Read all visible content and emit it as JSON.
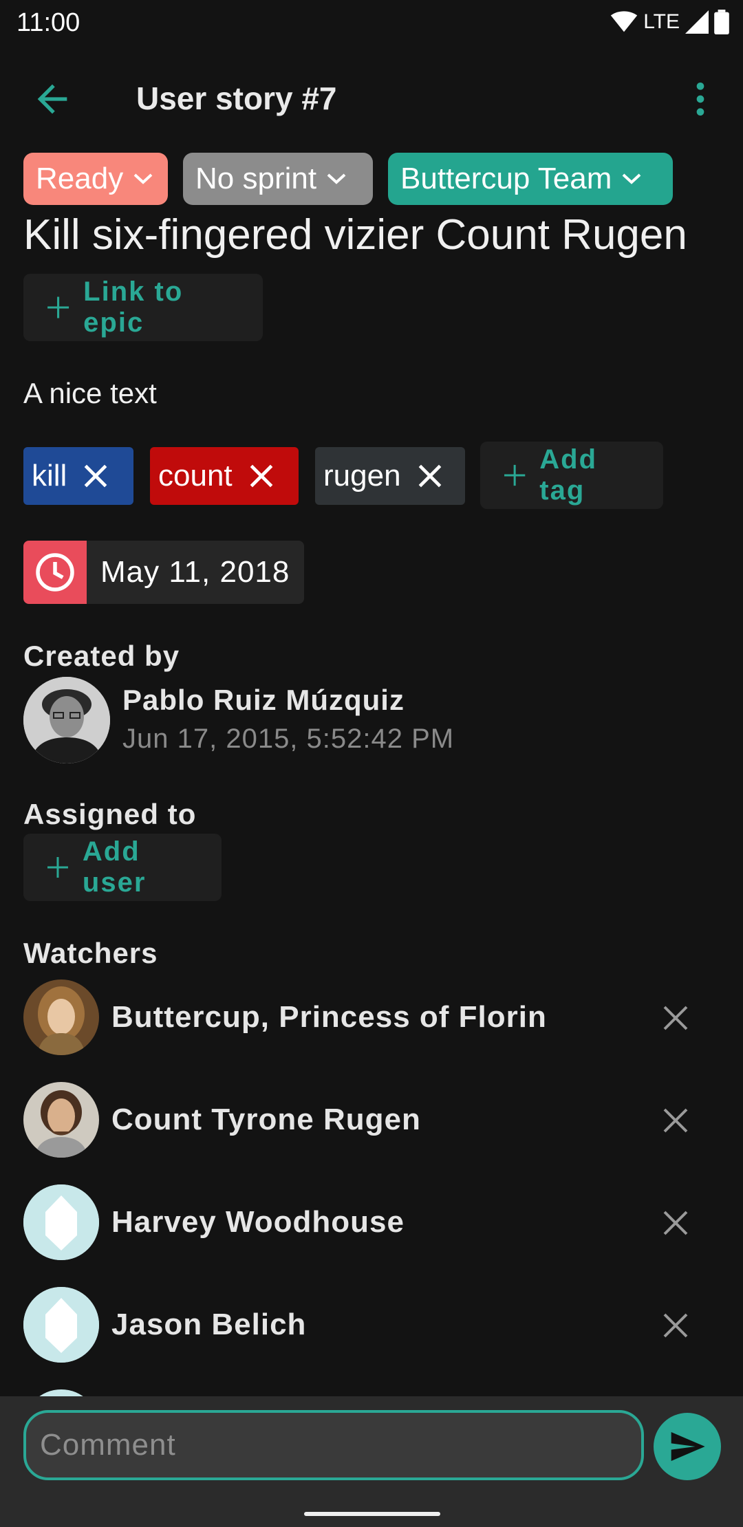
{
  "status_bar": {
    "time": "11:00",
    "network": "LTE"
  },
  "app_bar": {
    "title": "User story #7"
  },
  "chips": {
    "status": {
      "label": "Ready",
      "color": "#f8877b"
    },
    "sprint": {
      "label": "No sprint",
      "color": "#8c8c8c"
    },
    "team": {
      "label": "Buttercup Team",
      "color": "#24a58f"
    }
  },
  "story": {
    "title": "Kill six-fingered vizier Count Rugen",
    "link_epic_label": "Link to epic",
    "description": "A nice text"
  },
  "tags": [
    {
      "label": "kill",
      "color": "#1f4a96"
    },
    {
      "label": "count",
      "color": "#c00b0b"
    },
    {
      "label": "rugen",
      "color": "#2f3336"
    }
  ],
  "add_tag_label": "Add tag",
  "due_date": "May 11, 2018",
  "created_by": {
    "label": "Created by",
    "name": "Pablo Ruiz Múzquiz",
    "date": "Jun 17, 2015, 5:52:42 PM"
  },
  "assigned_to": {
    "label": "Assigned to",
    "add_user_label": "Add user"
  },
  "watchers": {
    "label": "Watchers",
    "items": [
      {
        "name": "Buttercup, Princess of Florin"
      },
      {
        "name": "Count Tyrone Rugen"
      },
      {
        "name": "Harvey Woodhouse"
      },
      {
        "name": "Jason Belich"
      }
    ]
  },
  "comment": {
    "placeholder": "Comment"
  },
  "accent": "#2aa895"
}
